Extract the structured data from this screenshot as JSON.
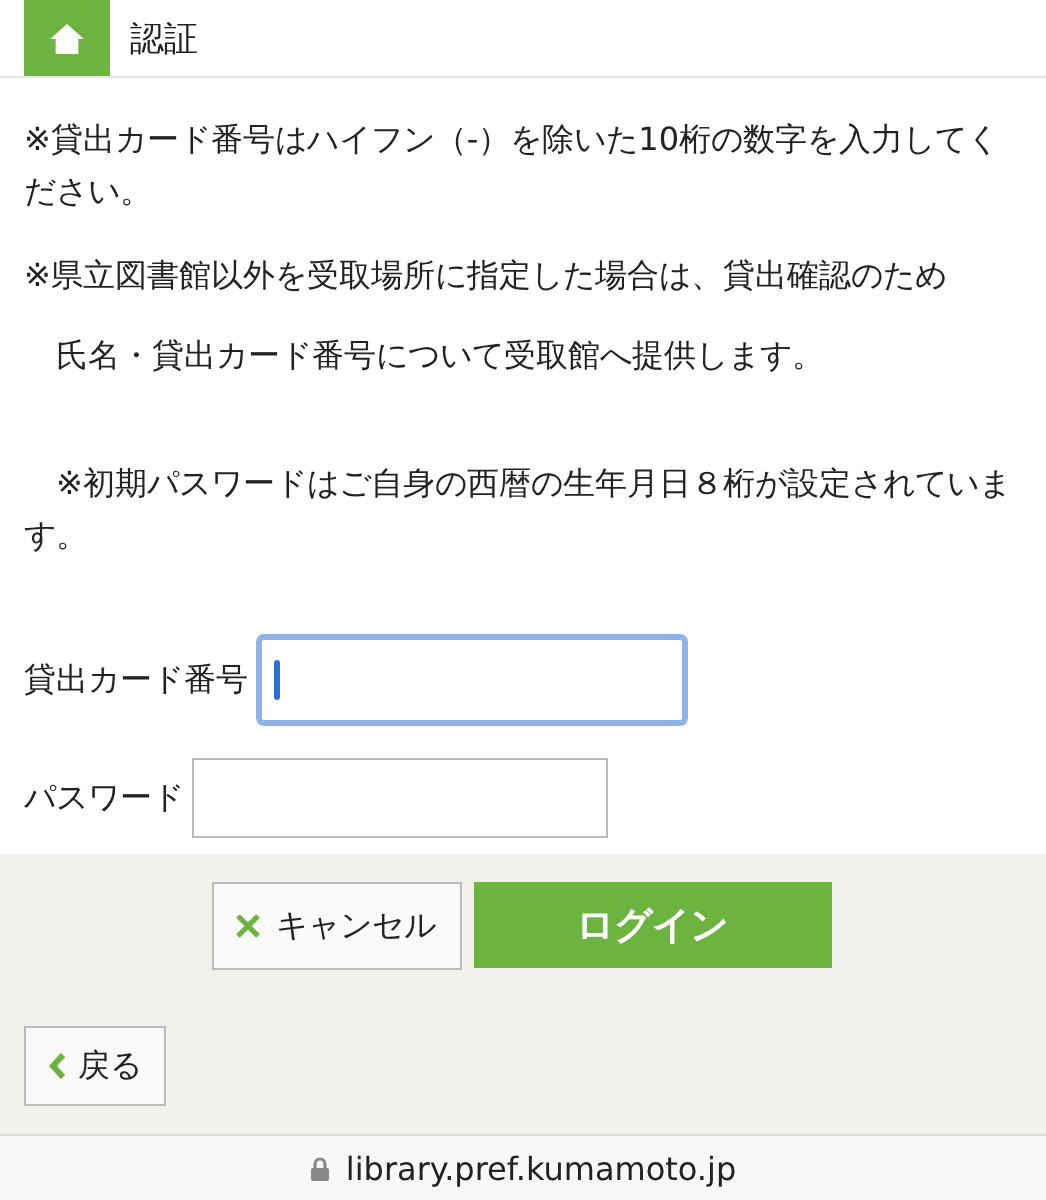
{
  "header": {
    "title": "認証"
  },
  "notes": [
    "※貸出カード番号はハイフン（-）を除いた10桁の数字を入力してください。",
    "※県立図書館以外を受取場所に指定した場合は、貸出確認のため",
    "　氏名・貸出カード番号について受取館へ提供します。",
    "　※初期パスワードはご自身の西暦の生年月日８桁が設定されています。"
  ],
  "fields": [
    {
      "label": "貸出カード番号",
      "focused": true
    },
    {
      "label": "パスワード",
      "focused": false
    }
  ],
  "buttons": {
    "cancel": "キャンセル",
    "login": "ログイン",
    "back": "戻る"
  },
  "address_bar": {
    "url": "library.pref.kumamoto.jp"
  }
}
